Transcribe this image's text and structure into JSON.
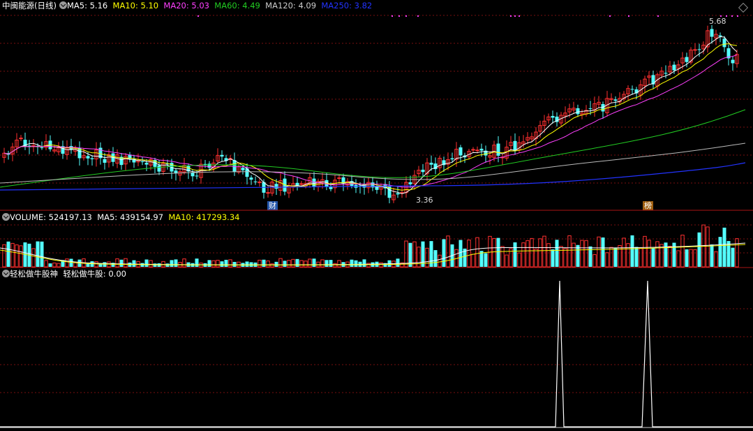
{
  "price_panel": {
    "title": "中闽能源(日线)",
    "ma5": "MA5: 5.16",
    "ma10": "MA10: 5.10",
    "ma20": "MA20: 5.03",
    "ma60": "MA60: 4.49",
    "ma120": "MA120: 4.09",
    "ma250": "MA250: 3.82",
    "high_label": "5.68",
    "low_label": "3.36",
    "marker_cai": "财",
    "marker_bang": "榜"
  },
  "volume_panel": {
    "volume": "VOLUME: 524197.13",
    "ma5": "MA5: 439154.97",
    "ma10": "MA10: 417293.34"
  },
  "indicator_panel": {
    "name": "轻松做牛股神",
    "value": "轻松做牛股: 0.00"
  },
  "colors": {
    "up": "#ff3030",
    "down": "#54ffff",
    "ma5": "#ffffff",
    "ma10": "#ffff00",
    "ma20": "#ff40ff",
    "ma60": "#22cc22",
    "ma120": "#bbbbbb",
    "ma250": "#2233ff"
  },
  "chart_data": {
    "type": "candlestick",
    "y_range": [
      3.36,
      5.68
    ],
    "signal_spikes": 2
  }
}
